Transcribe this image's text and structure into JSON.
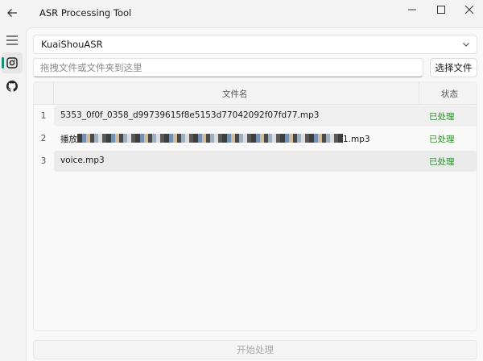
{
  "window": {
    "title": "ASR Processing Tool"
  },
  "engine": {
    "selected": "KuaiShouASR"
  },
  "file_input": {
    "placeholder": "拖拽文件或文件夹到这里",
    "select_label": "选择文件"
  },
  "table": {
    "headers": {
      "name": "文件名",
      "status": "状态"
    },
    "rows": [
      {
        "num": "1",
        "name": "5353_0f0f_0358_d99739615f8e5153d77042092f07fd77.mp3",
        "status": "已处理"
      },
      {
        "num": "2",
        "name_prefix": "播放",
        "name_suffix": "1.mp3",
        "status": "已处理"
      },
      {
        "num": "3",
        "name": "voice.mp3",
        "status": "已处理"
      }
    ]
  },
  "actions": {
    "start_label": "开始处理"
  },
  "icons": {
    "back": "back-arrow-icon",
    "menu": "hamburger-menu-icon",
    "asr": "asr-icon",
    "github": "github-icon",
    "minimize": "minimize-icon",
    "maximize": "maximize-icon",
    "close": "close-icon",
    "dropdown": "chevron-down-icon"
  },
  "colors": {
    "accent": "#1a8a7a",
    "status_done": "#2e8b2e",
    "disabled_text": "#a8a8a8"
  }
}
